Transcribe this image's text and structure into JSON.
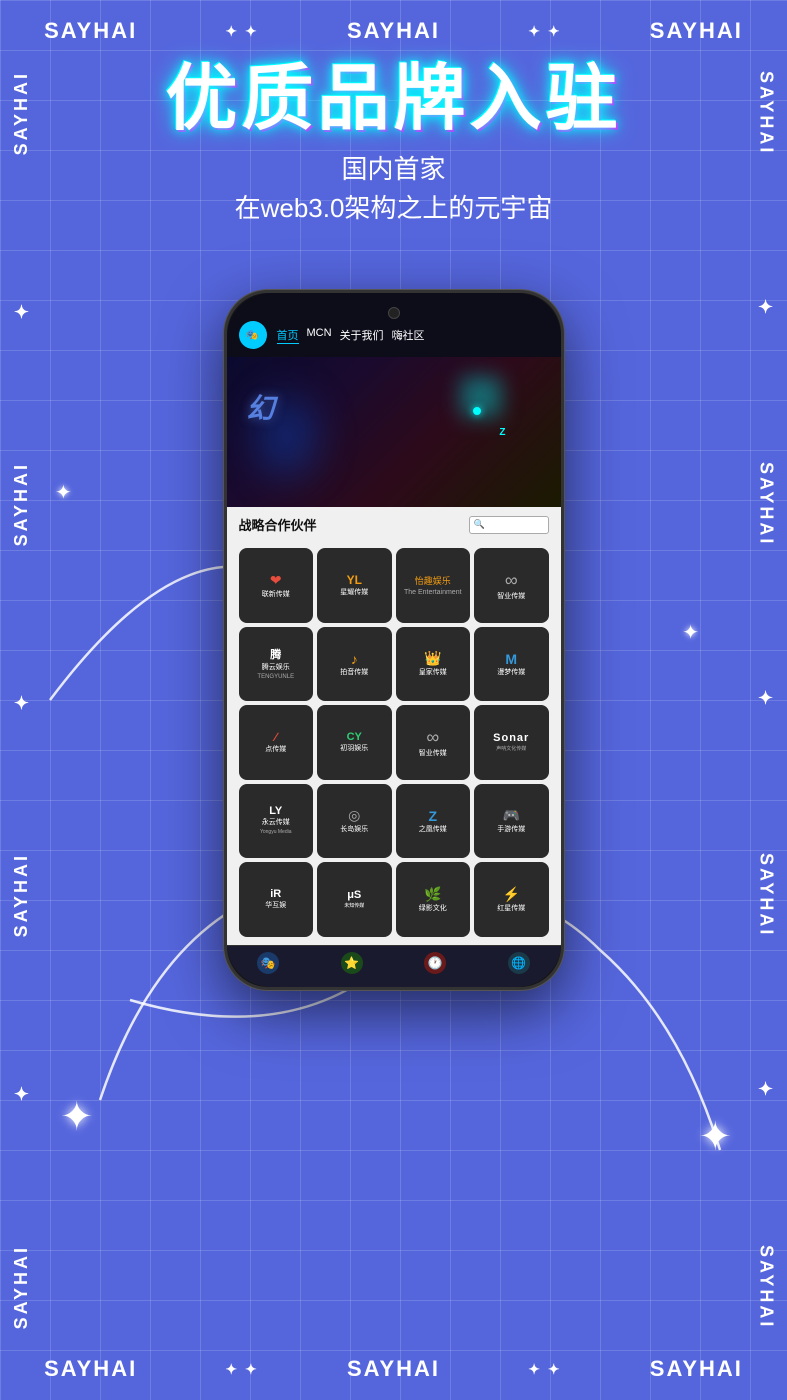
{
  "background": {
    "color": "#5566dd"
  },
  "watermarks": {
    "horizontal": [
      "SAYHAI",
      "✦ ✦",
      "SAYHAI",
      "✦ ✦",
      "SAYHAI"
    ],
    "vertical_items": [
      "SAYHAI",
      "SAYHAI",
      "SAYHAI",
      "SAYHAI",
      "SAYHAI"
    ]
  },
  "header": {
    "main_title": "优质品牌入驻",
    "sub_title1": "国内首家",
    "sub_title2": "在web3.0架构之上的元宇宙"
  },
  "phone": {
    "nav": {
      "logo_text": "🎭",
      "links": [
        "首页",
        "MCN",
        "关于我们",
        "嗨社区"
      ]
    },
    "partners_section": {
      "title": "战略合作伙伴",
      "search_placeholder": "🔍"
    },
    "brands": [
      {
        "name": "联新传媒",
        "icon": "❤",
        "color": "#c0392b"
      },
      {
        "name": "星耀传媒",
        "icon": "YL",
        "color": "#f39c12"
      },
      {
        "name": "怡趣娱乐",
        "icon": "怡趣",
        "color": "#2c3e50"
      },
      {
        "name": "智业传媒",
        "icon": "∞",
        "color": "#2c3e50"
      },
      {
        "name": "腾云娱乐",
        "icon": "腾",
        "color": "#2c3e50"
      },
      {
        "name": "拍音传媒",
        "icon": "♪",
        "color": "#f39c12"
      },
      {
        "name": "皇家传媒",
        "icon": "👑",
        "color": "#2c3e50"
      },
      {
        "name": "漫梦传媒",
        "icon": "M",
        "color": "#3498db"
      },
      {
        "name": "点传媒",
        "icon": "∕",
        "color": "#2c3e50"
      },
      {
        "name": "初羽娱乐",
        "icon": "CY",
        "color": "#2c3e50"
      },
      {
        "name": "智业传媒",
        "icon": "∞",
        "color": "#2c3e50"
      },
      {
        "name": "Sonar",
        "icon": "S",
        "color": "#2c3e50"
      },
      {
        "name": "永云传媒",
        "icon": "LY",
        "color": "#2c3e50"
      },
      {
        "name": "长岛娱乐",
        "icon": "◎",
        "color": "#2c3e50"
      },
      {
        "name": "之凰传媒",
        "icon": "Z",
        "color": "#2c3e50"
      },
      {
        "name": "手游传媒",
        "icon": "🎮",
        "color": "#f39c12"
      },
      {
        "name": "华互娱",
        "icon": "iR",
        "color": "#2c3e50"
      },
      {
        "name": "未知传媒",
        "icon": "μS",
        "color": "#2c3e50"
      },
      {
        "name": "绿影文化",
        "icon": "🌿",
        "color": "#2c3e50"
      },
      {
        "name": "红星传媒",
        "icon": "⚡",
        "color": "#c0392b"
      }
    ],
    "bottom_nav": [
      {
        "icon": "🎭",
        "color": "blue"
      },
      {
        "icon": "⭐",
        "color": "green"
      },
      {
        "icon": "🕐",
        "color": "red"
      },
      {
        "icon": "🌐",
        "color": "teal"
      }
    ]
  }
}
